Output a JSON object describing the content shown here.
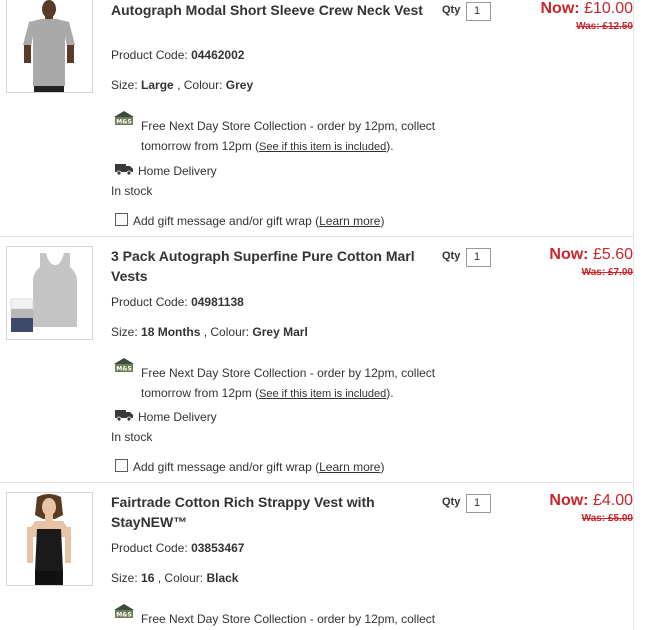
{
  "items": [
    {
      "title": "Autograph Modal Short Sleeve Crew Neck Vest",
      "code_label": "Product Code:",
      "code": "04462002",
      "size_label": "Size:",
      "size": "Large",
      "colour_label": ", Colour:",
      "colour": "Grey",
      "collection_text_1": "Free Next Day Store Collection - order by 12pm, collect",
      "collection_text_2": "tomorrow from 12pm (",
      "collection_link": "See if this item is included",
      "collection_text_3": ").",
      "delivery": "Home Delivery",
      "stock": "In stock",
      "gift_text": "Add gift message and/or gift wrap (",
      "gift_link": "Learn more",
      "gift_close": ")",
      "qty_label": "Qty",
      "qty": "1",
      "now_label": "Now:",
      "now_price": "£10.00",
      "was_price": "Was: £12.50"
    },
    {
      "title": "3 Pack Autograph Superfine Pure Cotton Marl Vests",
      "code_label": "Product Code:",
      "code": "04981138",
      "size_label": "Size:",
      "size": "18 Months",
      "colour_label": ", Colour:",
      "colour": "Grey Marl",
      "collection_text_1": "Free Next Day Store Collection - order by 12pm, collect",
      "collection_text_2": "tomorrow from 12pm (",
      "collection_link": "See if this item is included",
      "collection_text_3": ").",
      "delivery": "Home Delivery",
      "stock": "In stock",
      "gift_text": "Add gift message and/or gift wrap (",
      "gift_link": "Learn more",
      "gift_close": ")",
      "qty_label": "Qty",
      "qty": "1",
      "now_label": "Now:",
      "now_price": "£5.60",
      "was_price": "Was: £7.00"
    },
    {
      "title": "Fairtrade Cotton Rich Strappy Vest with StayNEW™",
      "code_label": "Product Code:",
      "code": "03853467",
      "size_label": "Size:",
      "size": "16",
      "colour_label": ", Colour:",
      "colour": "Black",
      "collection_text_1": "Free Next Day Store Collection - order by 12pm, collect",
      "qty_label": "Qty",
      "qty": "1",
      "now_label": "Now:",
      "now_price": "£4.00",
      "was_price": "Was: £5.00"
    }
  ],
  "icons": {
    "collection": "ms-store-icon",
    "delivery": "delivery-van-icon",
    "gift_checkbox": "checkbox"
  },
  "colors": {
    "price_red": "#c8252c",
    "text": "#333333",
    "divider": "#e2e2e2"
  }
}
